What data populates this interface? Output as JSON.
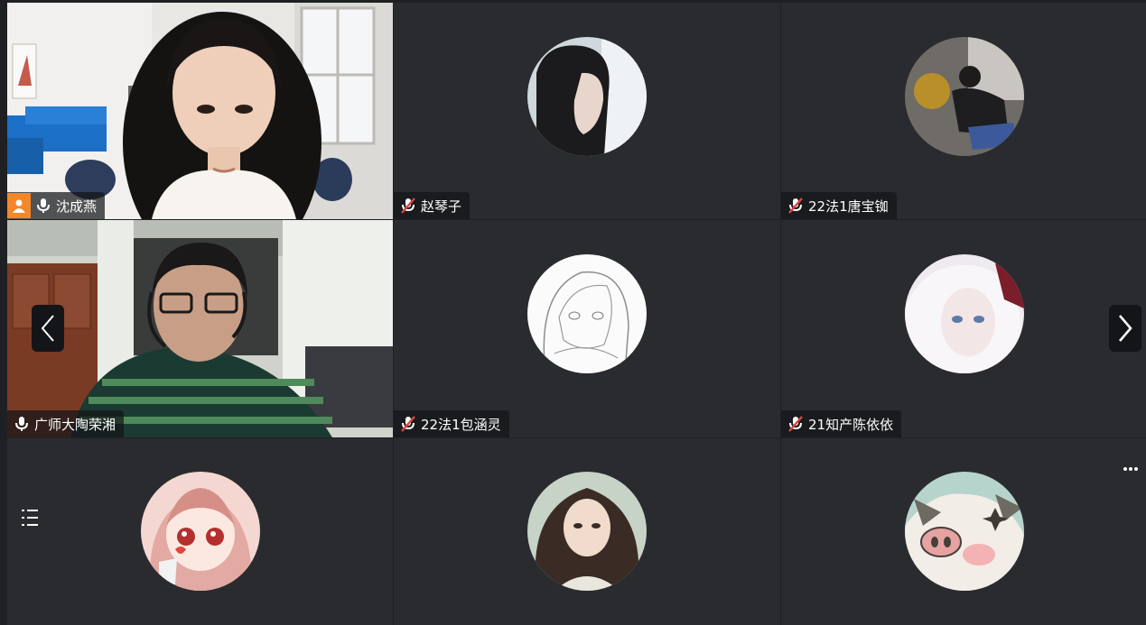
{
  "participants": [
    {
      "name": "沈成燕",
      "mic": "on",
      "type": "video",
      "active": true
    },
    {
      "name": "赵琴子",
      "mic": "muted",
      "type": "avatar"
    },
    {
      "name": "22法1唐宝铷",
      "mic": "muted",
      "type": "avatar"
    },
    {
      "name": "广师大陶荣湘",
      "mic": "on",
      "type": "video"
    },
    {
      "name": "22法1包涵灵",
      "mic": "muted",
      "type": "avatar"
    },
    {
      "name": "21知产陈依依",
      "mic": "muted",
      "type": "avatar"
    },
    {
      "name": "",
      "type": "avatar"
    },
    {
      "name": "",
      "type": "avatar"
    },
    {
      "name": "",
      "type": "avatar"
    }
  ],
  "icons": {
    "prev": "chevron-left-icon",
    "next": "chevron-right-icon",
    "list": "participant-list-icon",
    "more": "more-icon",
    "mic": "mic-icon",
    "mic_muted": "mic-muted-icon",
    "person": "person-icon"
  },
  "colors": {
    "background": "#1f2023",
    "tile": "#2a2b2f",
    "active_border": "#27b25a",
    "muted_red": "#e0463f",
    "person_badge": "#f5862a"
  }
}
